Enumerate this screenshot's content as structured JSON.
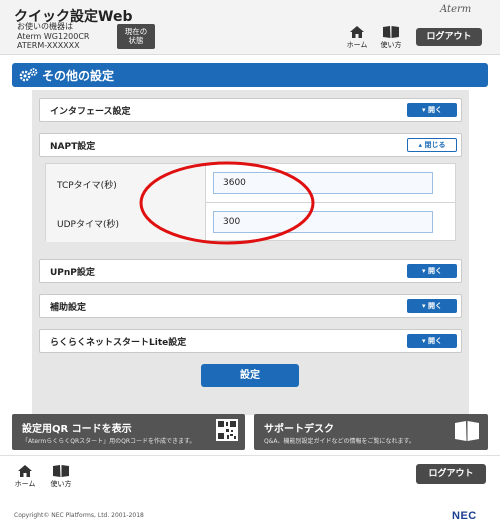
{
  "header": {
    "title": "クイック設定Web",
    "device_label": "お使いの機器は",
    "model": "Aterm WG1200CR",
    "device_name": "ATERM-XXXXXX",
    "status_button": "現在の\n状態",
    "brand": "Aterm",
    "home_label": "ホーム",
    "help_label": "使い方",
    "logout_label": "ログアウト"
  },
  "page": {
    "title": "その他の設定"
  },
  "sections": [
    {
      "title": "インタフェース設定",
      "toggle": "開く",
      "state": "collapsed"
    },
    {
      "title": "NAPT設定",
      "toggle": "閉じる",
      "state": "expanded"
    },
    {
      "title": "UPnP設定",
      "toggle": "開く",
      "state": "collapsed"
    },
    {
      "title": "補助設定",
      "toggle": "開く",
      "state": "collapsed"
    },
    {
      "title": "らくらくネットスタートLite設定",
      "toggle": "開く",
      "state": "collapsed"
    }
  ],
  "napt": {
    "rows": [
      {
        "label": "TCPタイマ(秒)",
        "value": "3600"
      },
      {
        "label": "UDPタイマ(秒)",
        "value": "300"
      }
    ]
  },
  "submit_label": "設定",
  "promos": {
    "qr": {
      "title": "設定用QR コードを表示",
      "subtitle": "「AtermらくらくQRスタート」用のQRコードを作成できます。"
    },
    "support": {
      "title": "サポートデスク",
      "subtitle": "Q&A、機能別設定ガイドなどの情報をご覧になれます。"
    }
  },
  "footer": {
    "home_label": "ホーム",
    "help_label": "使い方",
    "logout_label": "ログアウト",
    "copyright": "Copyright© NEC Platforms, Ltd. 2001-2018",
    "logo": "NEC"
  },
  "colors": {
    "accent": "#1d6bb8",
    "dark_button": "#4a4a4a",
    "annotation": "#e01010"
  }
}
